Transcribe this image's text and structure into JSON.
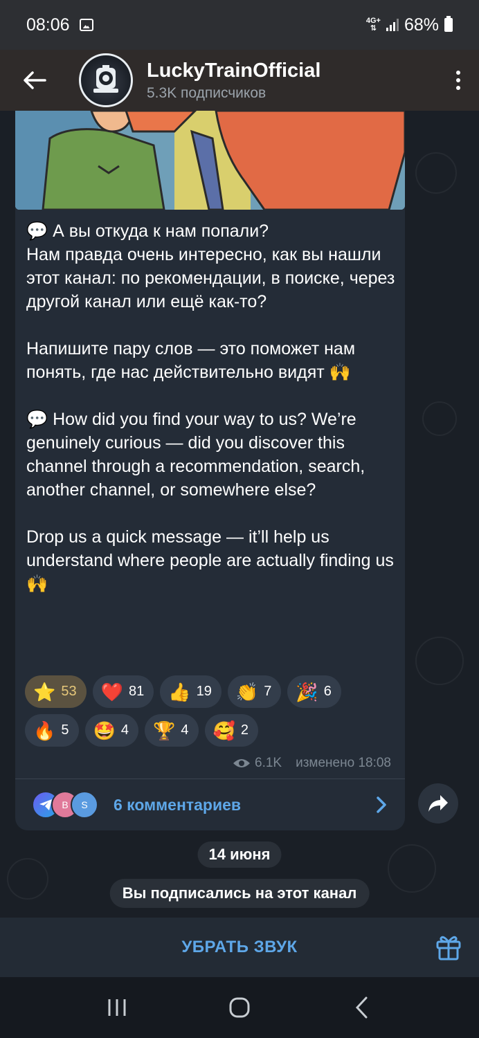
{
  "status_bar": {
    "time": "08:06",
    "network": "4G+",
    "battery": "68%"
  },
  "header": {
    "channel_name": "LuckyTrainOfficial",
    "subscribers": "5.3K подписчиков"
  },
  "message": {
    "text": "💬 А вы откуда к нам попали?\nНам правда очень интересно, как вы нашли этот канал: по рекомендации, в поиске, через другой канал или ещё как-то?\n\nНапишите пару слов — это поможет нам понять, где нас действительно видят 🙌\n\n💬 How did you find your way to us? We’re genuinely curious — did you discover this channel through a recommendation, search, another channel, or somewhere else?\n\nDrop us a quick message — it’ll help us understand where people are actually finding us 🙌",
    "reactions": [
      {
        "emoji": "⭐",
        "count": "53",
        "selected": true
      },
      {
        "emoji": "❤️",
        "count": "81"
      },
      {
        "emoji": "👍",
        "count": "19"
      },
      {
        "emoji": "👏",
        "count": "7"
      },
      {
        "emoji": "🎉",
        "count": "6"
      },
      {
        "emoji": "🔥",
        "count": "5"
      },
      {
        "emoji": "🤩",
        "count": "4"
      },
      {
        "emoji": "🏆",
        "count": "4"
      },
      {
        "emoji": "🥰",
        "count": "2"
      }
    ],
    "views": "6.1K",
    "edited_time": "изменено 18:08",
    "comment_avatars": [
      "",
      "B",
      "S"
    ],
    "comments_label": "6 комментариев"
  },
  "date_divider": "14 июня",
  "service_message": "Вы подписались на этот канал",
  "bottom_bar": {
    "mute_label": "УБРАТЬ ЗВУК"
  },
  "colors": {
    "accent": "#5ea7e8",
    "bubble": "#242c37",
    "header": "#2f2b2a"
  }
}
